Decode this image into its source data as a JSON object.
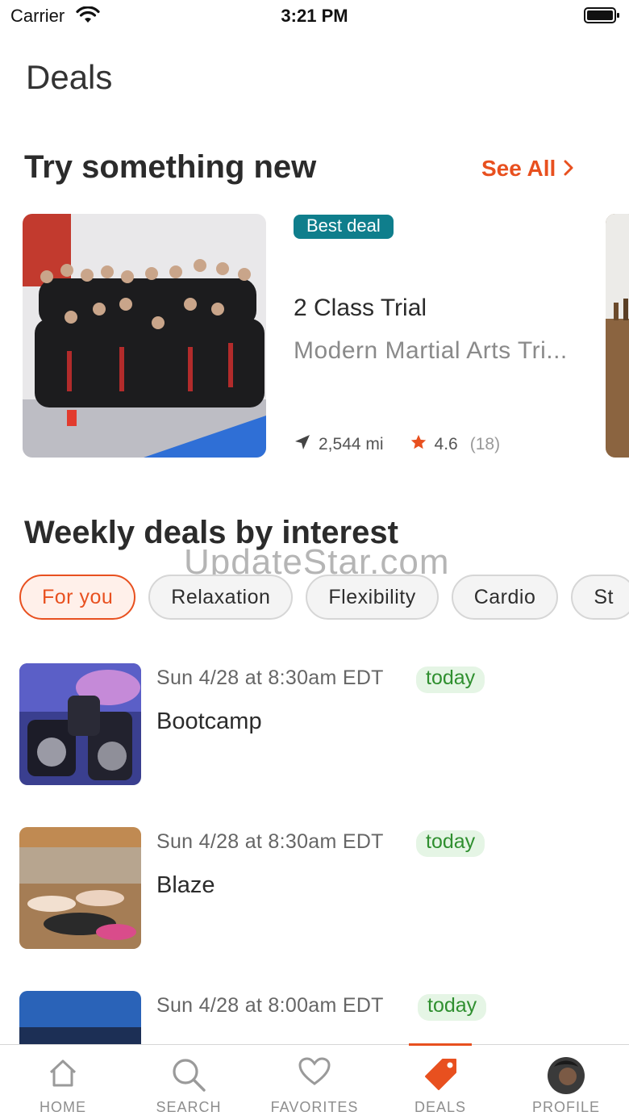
{
  "status_bar": {
    "carrier": "Carrier",
    "time": "3:21 PM"
  },
  "page": {
    "title": "Deals"
  },
  "featured": {
    "title": "Try something new",
    "see_all": "See All",
    "card": {
      "badge": "Best deal",
      "name": "2 Class Trial",
      "studio": "Modern Martial Arts Tri...",
      "distance": "2,544 mi",
      "rating": "4.6",
      "rating_count": "(18)"
    }
  },
  "weekly": {
    "title": "Weekly deals by interest",
    "chips": [
      "For you",
      "Relaxation",
      "Flexibility",
      "Cardio",
      "St"
    ]
  },
  "watermark": "UpdateStar.com",
  "classes": [
    {
      "time": "Sun 4/28 at 8:30am EDT",
      "badge": "today",
      "name": "Bootcamp"
    },
    {
      "time": "Sun 4/28 at 8:30am EDT",
      "badge": "today",
      "name": "Blaze"
    },
    {
      "time": "Sun 4/28 at 8:00am EDT",
      "badge": "today",
      "name": ""
    }
  ],
  "tabs": [
    "HOME",
    "SEARCH",
    "FAVORITES",
    "DEALS",
    "PROFILE"
  ],
  "colors": {
    "accent": "#e8501f",
    "badge_teal": "#0f7e8c",
    "today_green": "#2f8f2f"
  }
}
